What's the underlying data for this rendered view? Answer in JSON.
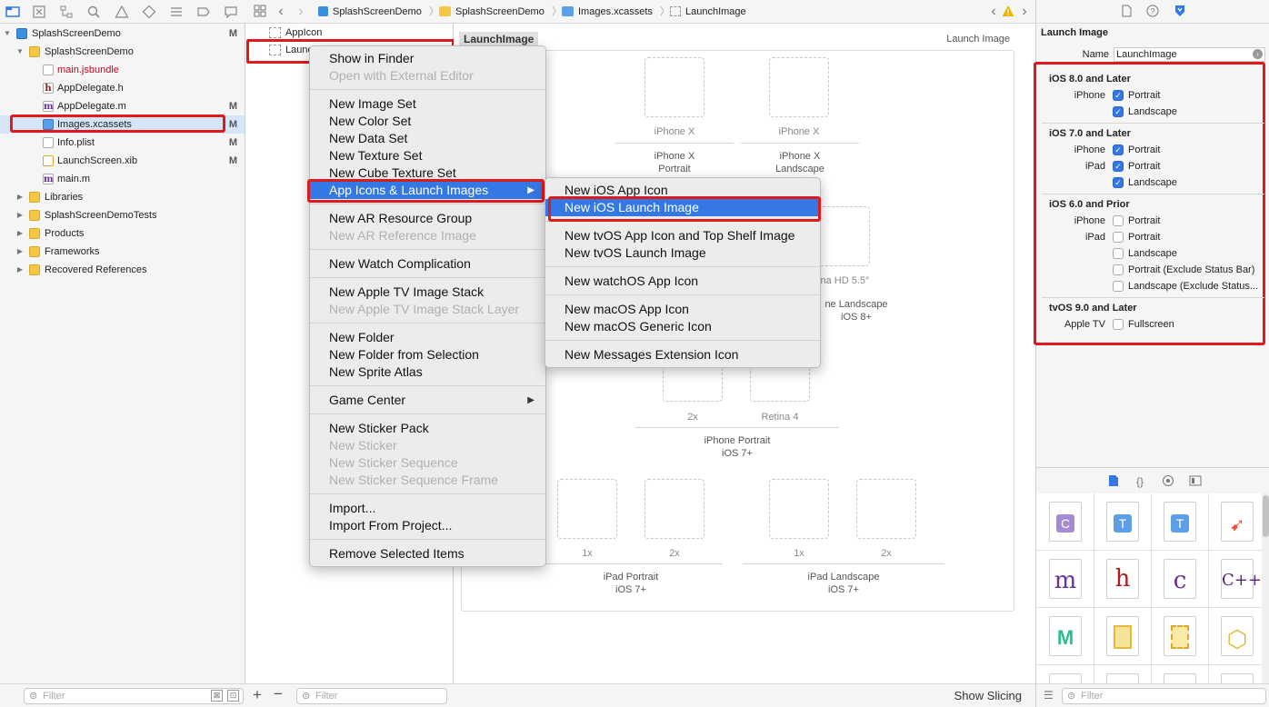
{
  "navigator": {
    "toolbar_icons": [
      "folder-icon",
      "source-control-icon",
      "hierarchy-icon",
      "search-icon",
      "warning-icon",
      "test-icon",
      "debug-icon",
      "breakpoint-icon",
      "report-icon"
    ],
    "items": [
      {
        "label": "SplashScreenDemo",
        "badge": "M"
      },
      {
        "label": "SplashScreenDemo",
        "badge": ""
      },
      {
        "label": "main.jsbundle",
        "badge": ""
      },
      {
        "label": "AppDelegate.h",
        "badge": ""
      },
      {
        "label": "AppDelegate.m",
        "badge": "M"
      },
      {
        "label": "Images.xcassets",
        "badge": "M"
      },
      {
        "label": "Info.plist",
        "badge": "M"
      },
      {
        "label": "LaunchScreen.xib",
        "badge": "M"
      },
      {
        "label": "main.m",
        "badge": ""
      },
      {
        "label": "Libraries",
        "badge": ""
      },
      {
        "label": "SplashScreenDemoTests",
        "badge": ""
      },
      {
        "label": "Products",
        "badge": ""
      },
      {
        "label": "Frameworks",
        "badge": ""
      },
      {
        "label": "Recovered References",
        "badge": ""
      }
    ],
    "filter_placeholder": "Filter"
  },
  "breadcrumb": [
    "SplashScreenDemo",
    "SplashScreenDemo",
    "Images.xcassets",
    "LaunchImage"
  ],
  "assets": {
    "items": [
      "AppIcon",
      "Launc"
    ],
    "filter_placeholder": "Filter"
  },
  "editor": {
    "title_tag": "LaunchImage",
    "header_right": "Launch Image",
    "slots": {
      "iphonex_a": "iPhone X",
      "iphonex_b": "iPhone X",
      "retina_hd": "tina HD 5.5″",
      "s2x": "2x",
      "retina4": "Retina 4",
      "ipad_p_1x": "1x",
      "ipad_p_2x": "2x",
      "ipad_l_1x": "1x",
      "ipad_l_2x": "2x"
    },
    "groups": {
      "iphonex_portrait_1": "iPhone X",
      "iphonex_portrait_2": "Portrait",
      "iphonex_landscape_1": "iPhone X",
      "iphonex_landscape_2": "Landscape",
      "landscape_ios8_1": "ne Landscape",
      "landscape_ios8_2": "iOS 8+",
      "iphone_portrait_1": "iPhone Portrait",
      "iphone_portrait_2": "iOS 7+",
      "ipad_portrait_1": "iPad Portrait",
      "ipad_portrait_2": "iOS 7+",
      "ipad_landscape_1": "iPad Landscape",
      "ipad_landscape_2": "iOS 7+"
    },
    "show_slicing": "Show Slicing"
  },
  "context_menu": {
    "items": [
      {
        "label": "Show in Finder",
        "disabled": false
      },
      {
        "label": "Open with External Editor",
        "disabled": true
      },
      {
        "label": "New Image Set",
        "disabled": false
      },
      {
        "label": "New Color Set",
        "disabled": false
      },
      {
        "label": "New Data Set",
        "disabled": false
      },
      {
        "label": "New Texture Set",
        "disabled": false
      },
      {
        "label": "New Cube Texture Set",
        "disabled": false
      },
      {
        "label": "App Icons & Launch Images",
        "disabled": false
      },
      {
        "label": "New AR Resource Group",
        "disabled": false
      },
      {
        "label": "New AR Reference Image",
        "disabled": true
      },
      {
        "label": "New Watch Complication",
        "disabled": false
      },
      {
        "label": "New Apple TV Image Stack",
        "disabled": false
      },
      {
        "label": "New Apple TV Image Stack Layer",
        "disabled": true
      },
      {
        "label": "New Folder",
        "disabled": false
      },
      {
        "label": "New Folder from Selection",
        "disabled": false
      },
      {
        "label": "New Sprite Atlas",
        "disabled": false
      },
      {
        "label": "Game Center",
        "disabled": false
      },
      {
        "label": "New Sticker Pack",
        "disabled": false
      },
      {
        "label": "New Sticker",
        "disabled": true
      },
      {
        "label": "New Sticker Sequence",
        "disabled": true
      },
      {
        "label": "New Sticker Sequence Frame",
        "disabled": true
      },
      {
        "label": "Import...",
        "disabled": false
      },
      {
        "label": "Import From Project...",
        "disabled": false
      },
      {
        "label": "Remove Selected Items",
        "disabled": false
      }
    ]
  },
  "submenu": {
    "items": [
      {
        "label": "New iOS App Icon"
      },
      {
        "label": "New iOS Launch Image"
      },
      {
        "label": "New tvOS App Icon and Top Shelf Image"
      },
      {
        "label": "New tvOS Launch Image"
      },
      {
        "label": "New watchOS App Icon"
      },
      {
        "label": "New macOS App Icon"
      },
      {
        "label": "New macOS Generic Icon"
      },
      {
        "label": "New Messages Extension Icon"
      }
    ]
  },
  "inspector": {
    "section_title": "Launch Image",
    "name_label": "Name",
    "name_value": "LaunchImage",
    "groups": {
      "ios8": "iOS 8.0 and Later",
      "ios7": "iOS 7.0 and Later",
      "ios6": "iOS 6.0 and Prior",
      "tvos9": "tvOS 9.0 and Later"
    },
    "labels": {
      "iphone": "iPhone",
      "ipad": "iPad",
      "appletv": "Apple TV",
      "portrait": "Portrait",
      "landscape": "Landscape",
      "portrait_excl": "Portrait (Exclude Status Bar)",
      "landscape_excl": "Landscape (Exclude Status...",
      "fullscreen": "Fullscreen"
    },
    "checks": {
      "ios8_iphone_portrait": true,
      "ios8_iphone_landscape": true,
      "ios7_iphone_portrait": true,
      "ios7_ipad_portrait": true,
      "ios7_ipad_landscape": true,
      "ios6_iphone_portrait": false,
      "ios6_ipad_portrait": false,
      "ios6_ipad_landscape": false,
      "ios6_ipad_portrait_excl": false,
      "ios6_ipad_landscape_excl": false,
      "tvos_fullscreen": false
    },
    "filter_placeholder": "Filter",
    "library_tiles": [
      "C",
      "T",
      "T",
      "swift",
      "m",
      "h",
      "c",
      "C++",
      "metal",
      "image",
      "scene",
      "cube",
      "doc",
      "doc",
      "doc",
      "doc"
    ]
  },
  "colors": {
    "accent": "#3478e6",
    "highlight_red": "#e01a1a",
    "selection": "#d6e6fa"
  }
}
